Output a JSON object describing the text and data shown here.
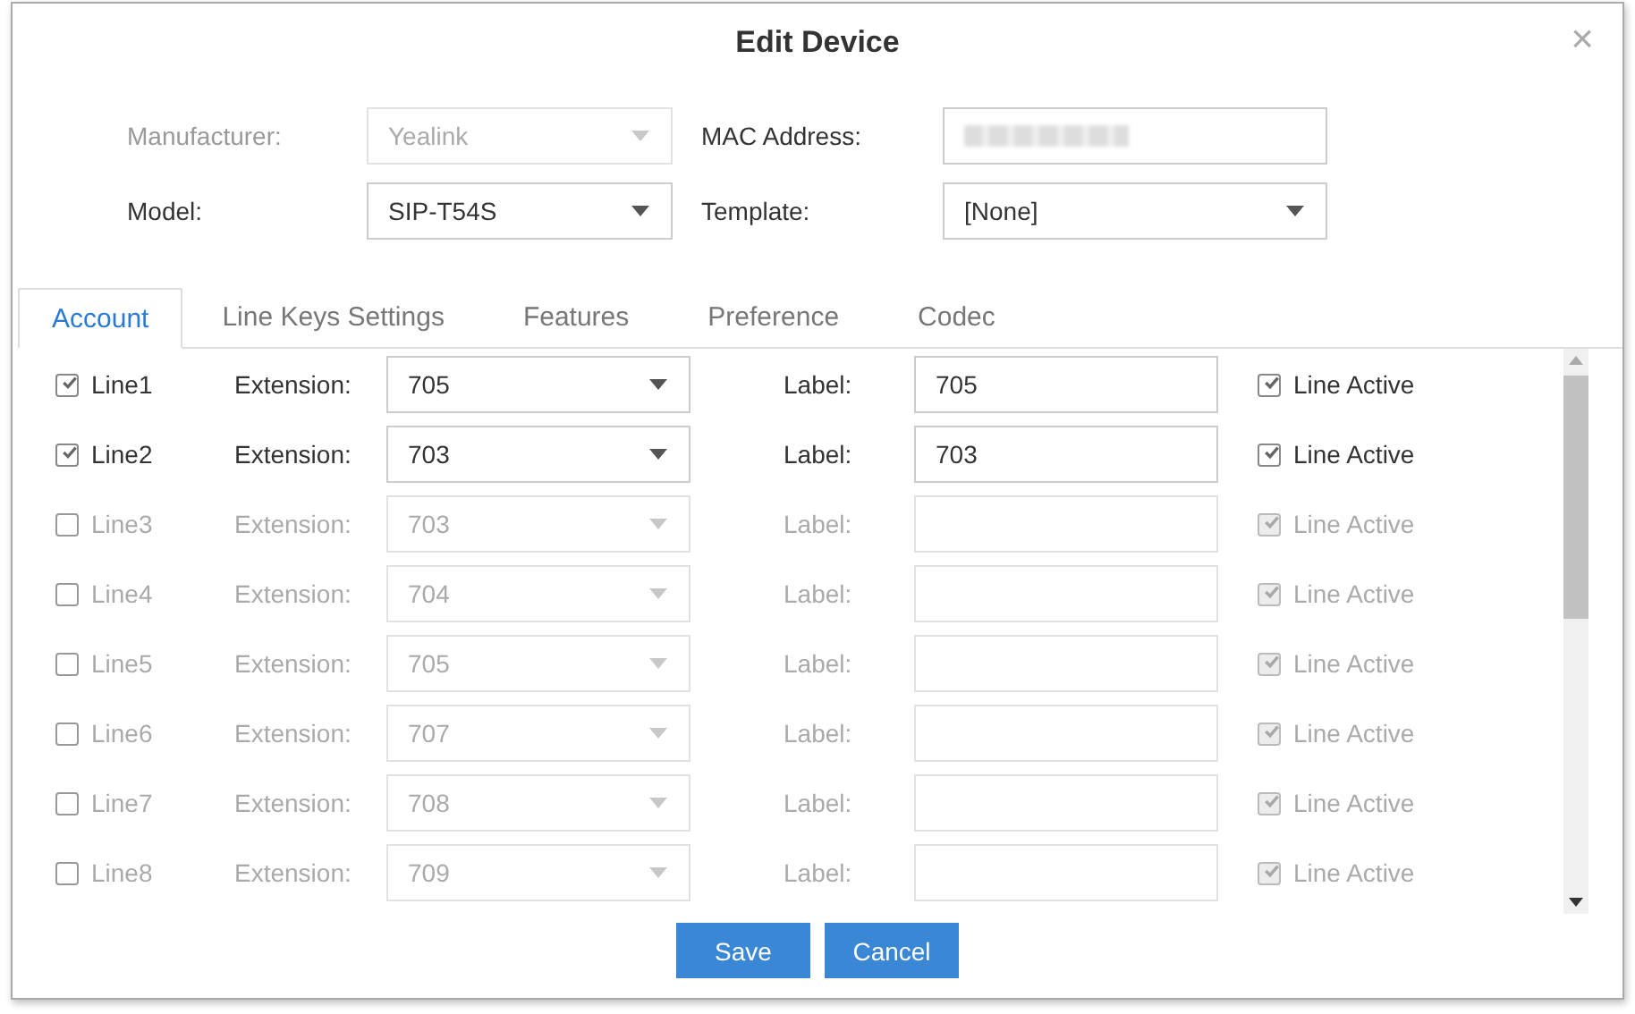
{
  "dialog": {
    "title": "Edit Device",
    "close": "×"
  },
  "form": [
    {
      "label": "Manufacturer:",
      "value": "Yealink",
      "kind": "select",
      "disabled": true
    },
    {
      "label": "MAC Address:",
      "kind": "redacted",
      "disabled": false
    },
    {
      "label": "Model:",
      "value": "SIP-T54S",
      "kind": "select",
      "disabled": false
    },
    {
      "label": "Template:",
      "value": "[None]",
      "kind": "select",
      "disabled": false
    }
  ],
  "tabs": [
    {
      "label": "Account",
      "selected": true
    },
    {
      "label": "Line Keys Settings",
      "selected": false
    },
    {
      "label": "Features",
      "selected": false
    },
    {
      "label": "Preference",
      "selected": false
    },
    {
      "label": "Codec",
      "selected": false
    }
  ],
  "lines": [
    {
      "name": "Line1",
      "checked": true,
      "ext_label": "Extension:",
      "extension": "705",
      "label_label": "Label:",
      "label": "705",
      "active_label": "Line Active",
      "active": true
    },
    {
      "name": "Line2",
      "checked": true,
      "ext_label": "Extension:",
      "extension": "703",
      "label_label": "Label:",
      "label": "703",
      "active_label": "Line Active",
      "active": true
    },
    {
      "name": "Line3",
      "checked": false,
      "ext_label": "Extension:",
      "extension": "703",
      "label_label": "Label:",
      "active_label": "Line Active",
      "active": true
    },
    {
      "name": "Line4",
      "checked": false,
      "ext_label": "Extension:",
      "extension": "704",
      "label_label": "Label:",
      "active_label": "Line Active",
      "active": true
    },
    {
      "name": "Line5",
      "checked": false,
      "ext_label": "Extension:",
      "extension": "705",
      "label_label": "Label:",
      "active_label": "Line Active",
      "active": true
    },
    {
      "name": "Line6",
      "checked": false,
      "ext_label": "Extension:",
      "extension": "707",
      "label_label": "Label:",
      "active_label": "Line Active",
      "active": true
    },
    {
      "name": "Line7",
      "checked": false,
      "ext_label": "Extension:",
      "extension": "708",
      "label_label": "Label:",
      "active_label": "Line Active",
      "active": true
    },
    {
      "name": "Line8",
      "checked": false,
      "ext_label": "Extension:",
      "extension": "709",
      "label_label": "Label:",
      "active_label": "Line Active",
      "active": true
    }
  ],
  "buttons": [
    "Save",
    "Cancel"
  ]
}
